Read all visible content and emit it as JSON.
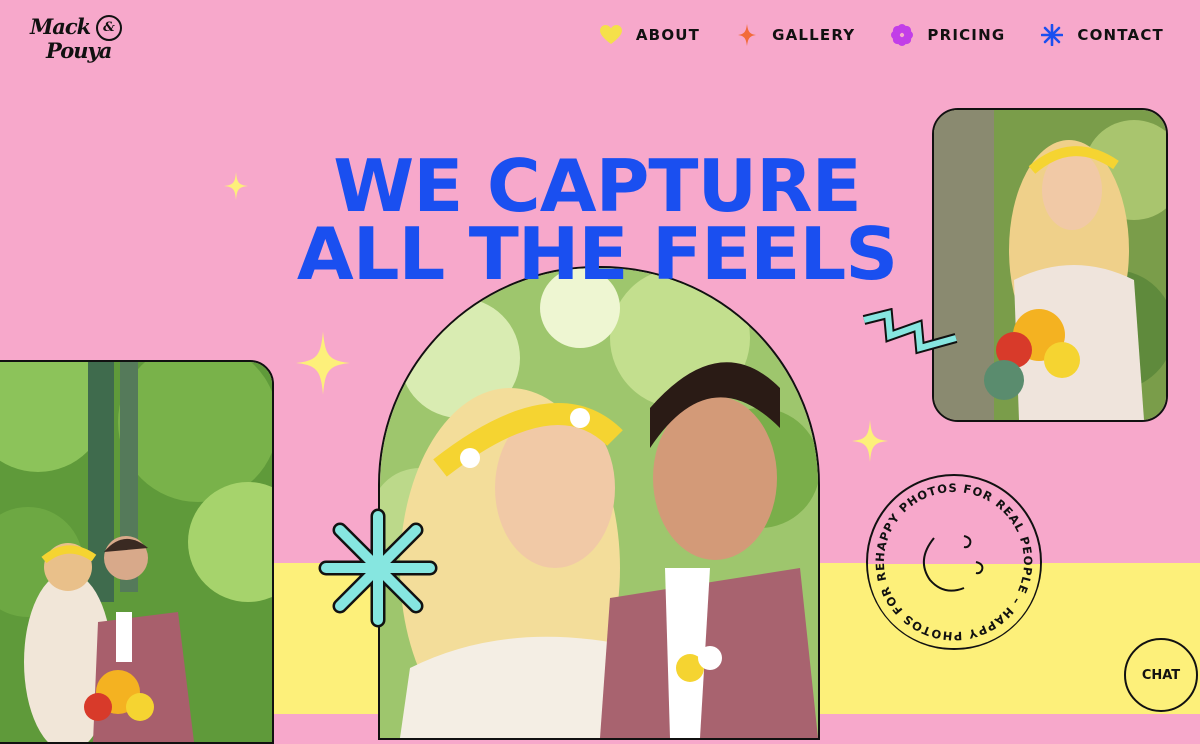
{
  "brand": {
    "line1": "Mack",
    "line2": "Pouya",
    "amp": "&"
  },
  "nav": {
    "items": [
      {
        "label": "ABOUT",
        "icon": "heart-icon",
        "color": "#f5e04a"
      },
      {
        "label": "GALLERY",
        "icon": "sparkle-icon",
        "color": "#f26b3a"
      },
      {
        "label": "PRICING",
        "icon": "flower-icon",
        "color": "#c23ee8"
      },
      {
        "label": "CONTACT",
        "icon": "asterisk-icon",
        "color": "#1a4ff0"
      }
    ]
  },
  "hero": {
    "line1": "WE CAPTURE",
    "line2": "ALL THE FEELS"
  },
  "badge": {
    "ring_text": "HAPPY PHOTOS FOR REAL PEOPLE – HAPPY PHOTOS FOR REAL PEOPLE – "
  },
  "chat": {
    "label": "CHAT"
  },
  "colors": {
    "background": "#f7a8cb",
    "band": "#fdf07a",
    "headline": "#1a4ff0",
    "accent_teal": "#86e6e0",
    "star": "#fdf07a"
  }
}
